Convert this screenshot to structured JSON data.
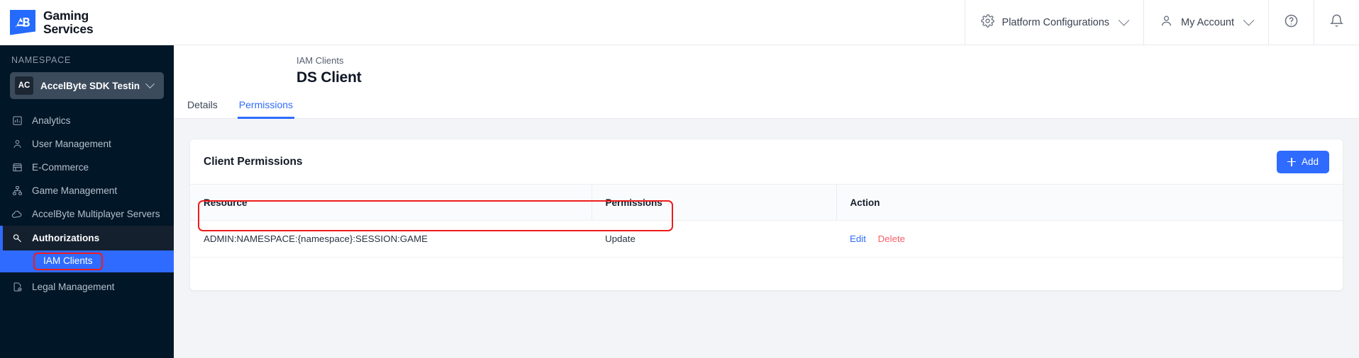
{
  "brand": {
    "logo_initials": "AB",
    "line1": "Gaming",
    "line2": "Services"
  },
  "topnav": {
    "platform_configurations": "Platform Configurations",
    "my_account": "My Account",
    "help_icon": "help-circle-icon",
    "notification_icon": "bell-icon",
    "gear_icon": "gear-icon",
    "user_icon": "user-icon"
  },
  "sidebar": {
    "namespace_label": "NAMESPACE",
    "namespace": {
      "initials": "AC",
      "name": "AccelByte SDK Testing"
    },
    "items": [
      {
        "label": "Analytics",
        "icon": "bar-chart-icon",
        "active": false
      },
      {
        "label": "User Management",
        "icon": "user-icon",
        "active": false
      },
      {
        "label": "E-Commerce",
        "icon": "store-icon",
        "active": false
      },
      {
        "label": "Game Management",
        "icon": "sitemap-icon",
        "active": false
      },
      {
        "label": "AccelByte Multiplayer Servers",
        "icon": "cloud-icon",
        "active": false
      },
      {
        "label": "Authorizations",
        "icon": "key-icon",
        "active": true
      },
      {
        "label": "Legal Management",
        "icon": "document-check-icon",
        "active": false
      }
    ],
    "sub_item": {
      "label": "IAM Clients",
      "highlighted": true
    }
  },
  "page": {
    "breadcrumb": "IAM Clients",
    "title": "DS Client",
    "tabs": [
      {
        "label": "Details",
        "active": false
      },
      {
        "label": "Permissions",
        "active": true
      }
    ]
  },
  "card": {
    "title": "Client Permissions",
    "add_label": "Add"
  },
  "table": {
    "columns": [
      "Resource",
      "Permissions",
      "Action"
    ],
    "rows": [
      {
        "resource": "ADMIN:NAMESPACE:{namespace}:SESSION:GAME",
        "permissions": "Update",
        "edit_label": "Edit",
        "delete_label": "Delete",
        "highlighted": true
      }
    ]
  },
  "colors": {
    "accent": "#2f6bff",
    "sidebar_bg": "#011627",
    "danger": "#ee1c1c",
    "delete_link": "#f4606c",
    "page_bg": "#f2f4f7"
  }
}
